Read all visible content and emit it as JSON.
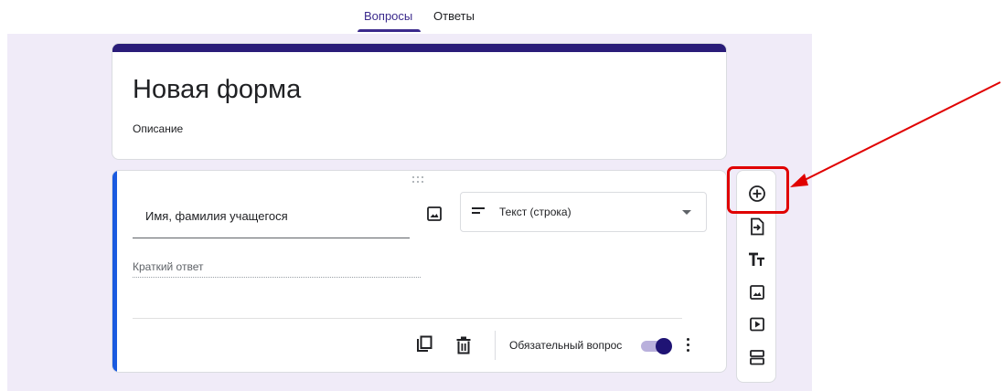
{
  "tabs": [
    {
      "label": "Вопросы",
      "active": true
    },
    {
      "label": "Ответы",
      "active": false
    }
  ],
  "form": {
    "title": "Новая форма",
    "description_placeholder": "Описание"
  },
  "question": {
    "title": "Имя, фамилия учащегося",
    "type_label": "Текст (строка)",
    "answer_placeholder": "Краткий ответ",
    "required_label": "Обязательный вопрос",
    "required": true
  },
  "toolbar": {
    "items": [
      "add-question-icon",
      "import-questions-icon",
      "add-title-icon",
      "add-image-icon",
      "add-video-icon",
      "add-section-icon"
    ]
  },
  "colors": {
    "theme": "#2a1c79",
    "background": "#f0ebf8",
    "active_bar": "#1a5ae0",
    "annotation": "#e00000"
  }
}
